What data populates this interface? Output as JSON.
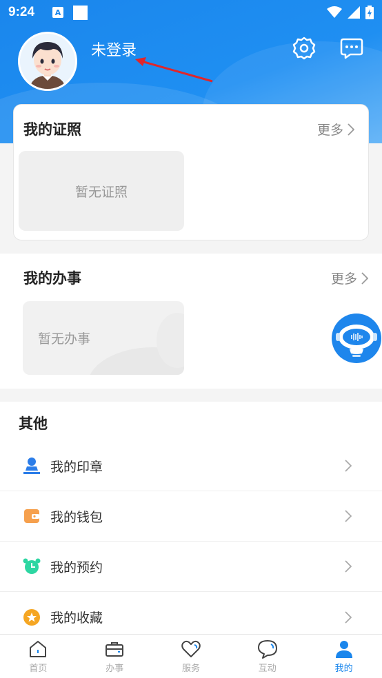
{
  "status_bar": {
    "time": "9:24",
    "notif_letter": "A"
  },
  "header": {
    "login_status": "未登录"
  },
  "certificates": {
    "title": "我的证照",
    "more_label": "更多",
    "empty_text": "暂无证照"
  },
  "affairs": {
    "title": "我的办事",
    "more_label": "更多",
    "empty_text": "暂无办事"
  },
  "other": {
    "title": "其他",
    "items": [
      {
        "label": "我的印章",
        "icon": "seal-icon",
        "color": "#2b7de9"
      },
      {
        "label": "我的钱包",
        "icon": "wallet-icon",
        "color": "#f6a04d"
      },
      {
        "label": "我的预约",
        "icon": "alarm-clock-icon",
        "color": "#2dd6a2"
      },
      {
        "label": "我的收藏",
        "icon": "star-icon",
        "color": "#f5a623"
      }
    ]
  },
  "tabbar": {
    "tabs": [
      {
        "label": "首页",
        "icon": "home-icon"
      },
      {
        "label": "办事",
        "icon": "briefcase-icon"
      },
      {
        "label": "服务",
        "icon": "heart-icon"
      },
      {
        "label": "互动",
        "icon": "chat-bubble-icon"
      },
      {
        "label": "我的",
        "icon": "user-icon",
        "active": true
      }
    ],
    "active_color": "#1a86ec"
  },
  "colors": {
    "primary": "#1a86ec",
    "background": "#f4f4f4"
  }
}
